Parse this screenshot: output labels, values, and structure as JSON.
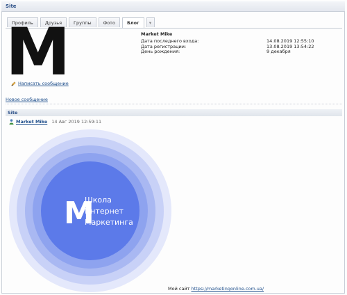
{
  "window": {
    "title": "Site"
  },
  "tabs": [
    {
      "label": "Профиль",
      "active": false
    },
    {
      "label": "Друзья",
      "active": false
    },
    {
      "label": "Группы",
      "active": false
    },
    {
      "label": "Фото",
      "active": false
    },
    {
      "label": "Блог",
      "active": true
    }
  ],
  "profile": {
    "avatar_letter": "M",
    "name": "Market Mike",
    "last_login_label": "Дата последнего входа:",
    "last_login_value": "14.08.2019 12:55:10",
    "registration_label": "Дата регистрации:",
    "registration_value": "13.08.2019 13:54:22",
    "birthday_label": "День рождения:",
    "birthday_value": "9 декабря",
    "write_message": "Написать сообщение",
    "new_message": "Новое сообщение"
  },
  "blog": {
    "section_title": "Site",
    "author": "Market Mike",
    "date": "14 Авг 2019 12:59:11",
    "logo": {
      "letter": "M",
      "line1": "Школа",
      "line2": "Интернет",
      "line3": "Маркетинга",
      "colors": [
        "#e4e8fb",
        "#c8d1f7",
        "#a9b8f2",
        "#8ea3ef",
        "#5c7ae9"
      ]
    },
    "footer_prefix": "Мой сайт",
    "footer_link": "https://marketingonline.com.ua/"
  },
  "colors": {
    "link": "#1f4f8c",
    "header_text": "#2b4f87"
  }
}
